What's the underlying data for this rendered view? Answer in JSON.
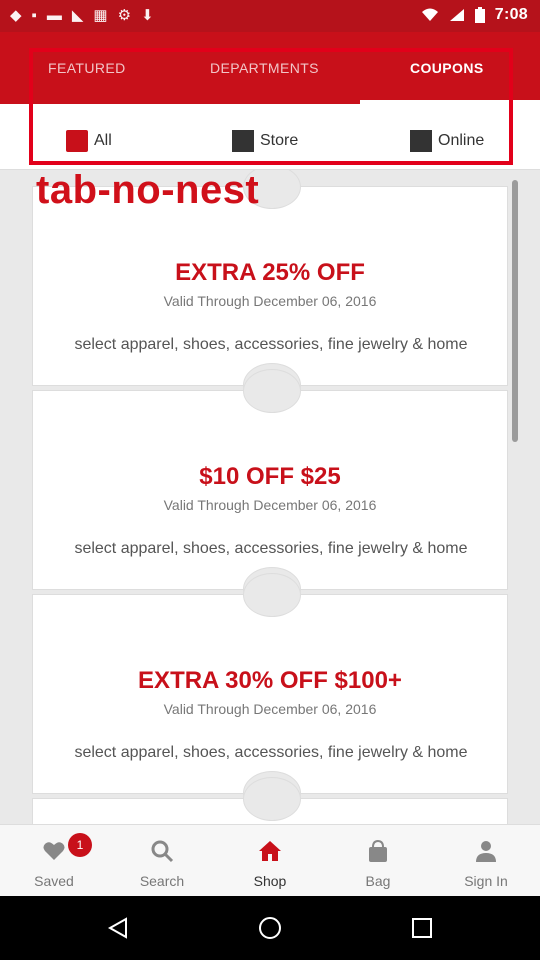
{
  "status_bar": {
    "time": "7:08",
    "left_icons": [
      "notification-icon",
      "shirt-icon",
      "car-icon",
      "tag-icon",
      "grid-icon",
      "settings-icon",
      "download-icon"
    ],
    "right_icons": [
      "wifi-icon",
      "signal-icon",
      "battery-icon"
    ]
  },
  "tabs": [
    {
      "label": "FEATURED",
      "active": false
    },
    {
      "label": "DEPARTMENTS",
      "active": false
    },
    {
      "label": "COUPONS",
      "active": true
    }
  ],
  "filters": [
    {
      "label": "All",
      "icon": "all-icon"
    },
    {
      "label": "Store",
      "icon": "store-icon"
    },
    {
      "label": "Online",
      "icon": "online-icon"
    }
  ],
  "annotation": {
    "label": "tab-no-nest"
  },
  "coupons": [
    {
      "title": "EXTRA 25% OFF",
      "valid": "Valid Through December 06, 2016",
      "description": "select apparel, shoes, accessories, fine jewelry & home"
    },
    {
      "title": "$10 OFF $25",
      "valid": "Valid Through December 06, 2016",
      "description": "select apparel, shoes, accessories, fine jewelry & home"
    },
    {
      "title": "EXTRA 30% OFF $100+",
      "valid": "Valid Through December 06, 2016",
      "description": "select apparel, shoes, accessories, fine jewelry & home"
    }
  ],
  "bottom_nav": [
    {
      "label": "Saved",
      "icon": "heart-icon",
      "badge": "1"
    },
    {
      "label": "Search",
      "icon": "search-icon"
    },
    {
      "label": "Shop",
      "icon": "home-icon",
      "active": true
    },
    {
      "label": "Bag",
      "icon": "bag-icon"
    },
    {
      "label": "Sign In",
      "icon": "person-icon"
    }
  ],
  "colors": {
    "brand_red": "#c8101a",
    "annotation_red": "#e2001a",
    "background": "#e9e9e9"
  }
}
